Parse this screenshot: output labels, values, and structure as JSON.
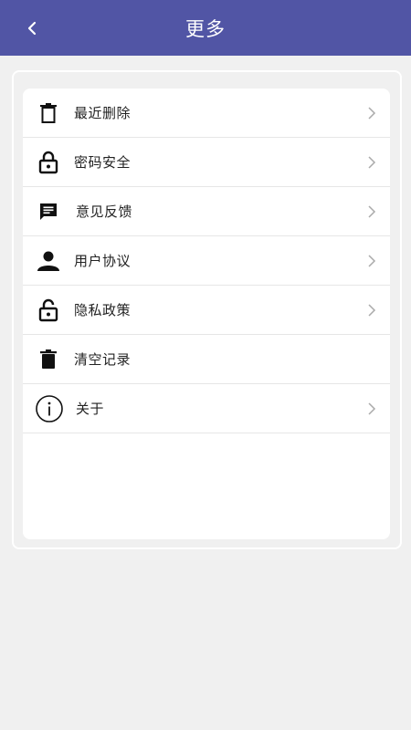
{
  "header": {
    "title": "更多",
    "back_icon": "chevron-left-icon",
    "background_color": "#5155a5"
  },
  "menu": {
    "items": [
      {
        "label": "最近删除",
        "icon": "trash-outline-icon",
        "has_chevron": true
      },
      {
        "label": "密码安全",
        "icon": "lock-icon",
        "has_chevron": true
      },
      {
        "label": "意见反馈",
        "icon": "feedback-icon",
        "has_chevron": true
      },
      {
        "label": "用户协议",
        "icon": "person-icon",
        "has_chevron": true
      },
      {
        "label": "隐私政策",
        "icon": "unlock-icon",
        "has_chevron": true
      },
      {
        "label": "清空记录",
        "icon": "trash-filled-icon",
        "has_chevron": false
      },
      {
        "label": "关于",
        "icon": "info-icon",
        "has_chevron": true
      }
    ]
  }
}
